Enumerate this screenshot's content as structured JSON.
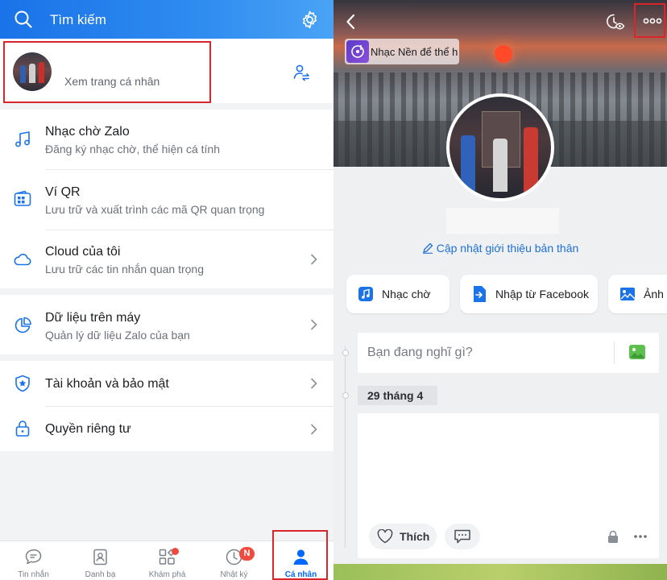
{
  "left": {
    "header": {
      "search_label": "Tìm kiếm"
    },
    "profile": {
      "subtitle": "Xem trang cá nhân"
    },
    "menu": [
      {
        "title": "Nhạc chờ Zalo",
        "subtitle": "Đăng ký nhạc chờ, thể hiện cá tính"
      },
      {
        "title": "Ví QR",
        "subtitle": "Lưu trữ và xuất trình các mã QR quan trọng"
      },
      {
        "title": "Cloud của tôi",
        "subtitle": "Lưu trữ các tin nhắn quan trọng"
      },
      {
        "title": "Dữ liệu trên máy",
        "subtitle": "Quản lý dữ liệu Zalo của bạn"
      },
      {
        "title": "Tài khoản và bảo mật"
      },
      {
        "title": "Quyền riêng tư"
      }
    ],
    "tabs": [
      {
        "label": "Tin nhắn"
      },
      {
        "label": "Danh bạ"
      },
      {
        "label": "Khám phá"
      },
      {
        "label": "Nhật ký",
        "badge": "N"
      },
      {
        "label": "Cá nhân"
      }
    ]
  },
  "right": {
    "music_chip": "Nhạc Nền để thể hiện",
    "intro_link": "Cập nhật giới thiệu bản thân",
    "quick_buttons": [
      {
        "label": "Nhạc chờ"
      },
      {
        "label": "Nhập từ Facebook"
      },
      {
        "label": "Ảnh c"
      }
    ],
    "composer_placeholder": "Bạn đang nghĩ gì?",
    "date_chip": "29 tháng 4",
    "post": {
      "like_label": "Thích"
    }
  },
  "colors": {
    "brand": "#0068ff",
    "highlight": "#d9262a",
    "badge": "#ef4b3f"
  }
}
